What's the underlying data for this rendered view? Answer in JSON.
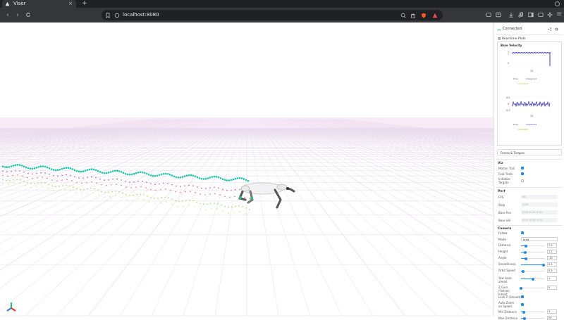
{
  "browser": {
    "tab_title": "Viser",
    "url": "localhost:8080"
  },
  "panel": {
    "status": "Connected",
    "realtime_title": "Real-time Plots",
    "base_velocity": "Base Velocity",
    "plot1": {
      "y_top": "2",
      "y_mid": "0",
      "x_label": "15",
      "legend1": "time",
      "legend2": "measured",
      "legend3": "command"
    },
    "plot2": {
      "y_top": "0.2",
      "y_mid": "0",
      "y_bot": "-0.2",
      "x_label": "15",
      "legend1": "time",
      "legend2": "measured",
      "legend3": "command"
    },
    "forces_title": "Forces & Torques",
    "viz": {
      "title": "Viz",
      "items": [
        {
          "label": "Motion Trail",
          "checked": true
        },
        {
          "label": "Foot Trails",
          "checked": true
        },
        {
          "label": "Initialize Targets",
          "checked": false
        }
      ]
    },
    "perf": {
      "title": "Perf",
      "items": [
        {
          "label": "FPS",
          "value": "60"
        },
        {
          "label": "Step",
          "value": "1.00"
        },
        {
          "label": "Base Pos",
          "value": "0.00, 0.00, 0.29"
        },
        {
          "label": "Base Vel",
          "value": "0.00, 0.00, 0.00"
        }
      ]
    },
    "camera": {
      "title": "Camera",
      "follow_label": "Follow",
      "mode_label": "Mode",
      "mode_value": "orbit",
      "sliders": [
        {
          "label": "Distance",
          "value": "7.5",
          "frac": 0.2
        },
        {
          "label": "Height",
          "value": "1.2",
          "frac": 0.18
        },
        {
          "label": "Angle",
          "value": "-10",
          "frac": 0.22
        },
        {
          "label": "Smoothness",
          "value": "0.5",
          "frac": 0.95
        },
        {
          "label": "Orbit Speed",
          "value": "0.5",
          "frac": 0.1
        },
        {
          "label": "Yaw Look-ahead",
          "value": "1",
          "frac": 0.5
        },
        {
          "label": "Z Gain (Follow) Inhibit",
          "value": "0",
          "frac": 0.0
        }
      ],
      "lock_label": "Lock Z (Smooth)",
      "auto_label": "Auto Zoom on Speed",
      "min_label": "Min Distance",
      "min_value": "3",
      "max_label": "Max Distance",
      "max_value": "20",
      "min_frac": 0.12,
      "max_frac": 0.16
    }
  }
}
